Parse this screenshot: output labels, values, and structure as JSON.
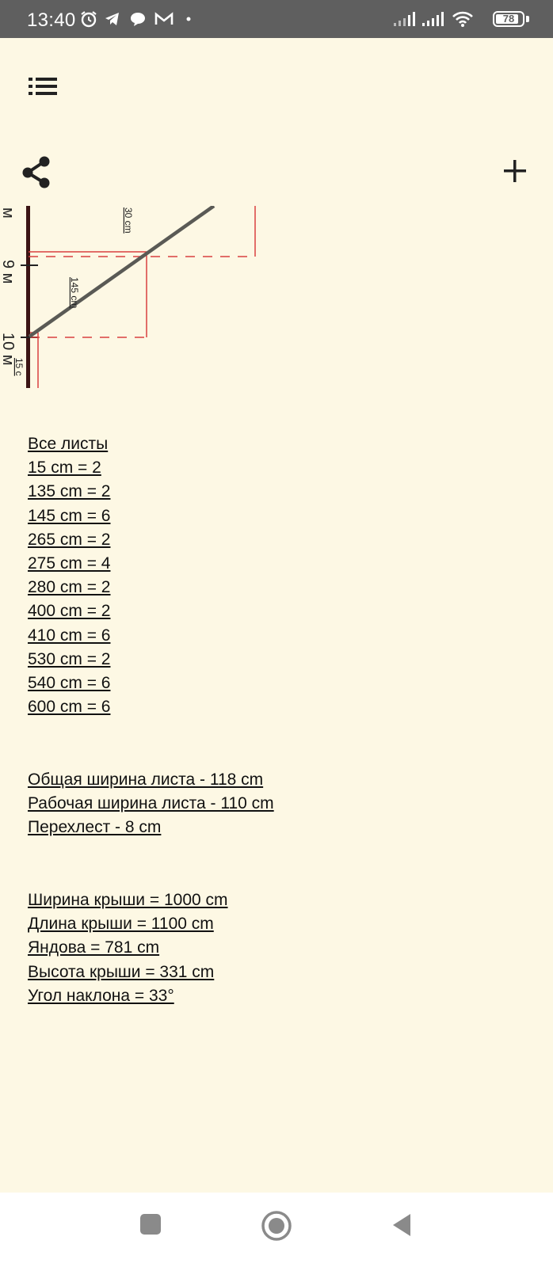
{
  "status_bar": {
    "time": "13:40",
    "battery": "78",
    "icons": [
      "alarm-icon",
      "telegram-icon",
      "chat-icon",
      "gmail-icon",
      "dot-icon",
      "signal-icon",
      "signal-icon",
      "wifi-icon",
      "battery-icon"
    ]
  },
  "toolbar": {
    "menu_icon": "menu-icon",
    "share_icon": "share-icon",
    "add_icon": "plus-icon"
  },
  "diagram": {
    "labels": {
      "top_width": "30 cm",
      "sheet_length": "145 cm",
      "bottom_width": "15 c",
      "mark_top": "м",
      "mark_9": "9 м",
      "mark_10": "10 м"
    },
    "colors": {
      "rafter": "#3c1414",
      "valley": "#5a5a55",
      "sheet": "#d94040"
    }
  },
  "sheets": {
    "title": "Все листы",
    "items": [
      "15 cm = 2",
      "135 cm = 2",
      "145 cm = 6",
      "265 cm = 2",
      "275 cm = 4",
      "280 cm = 2",
      "400 cm = 2",
      "410 cm = 6",
      "530 cm = 2",
      "540 cm = 6",
      "600 cm = 6"
    ]
  },
  "sheet_params": [
    "Общая ширина листа -  118 cm",
    "Рабочая ширина листа -  110 cm",
    "Перехлест -  8 cm"
  ],
  "roof_params": [
    "Ширина крыши = 1000 cm",
    "Длина крыши = 1100 cm",
    "Яндова = 781 cm",
    "Высота крыши = 331 cm",
    "Угол наклона = 33°"
  ],
  "nav_bar": {
    "icons": [
      "recents-icon",
      "home-icon",
      "back-icon"
    ],
    "color": "#8a8a8a"
  }
}
